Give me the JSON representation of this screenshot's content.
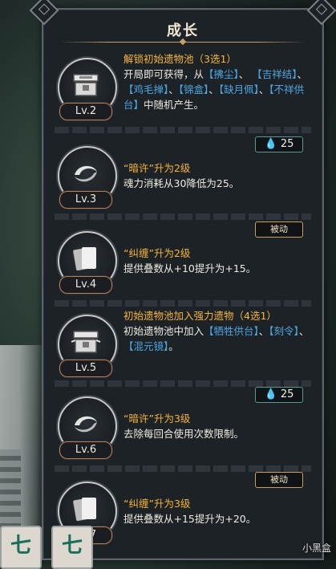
{
  "panel": {
    "title": "成长"
  },
  "entries": [
    {
      "level": "Lv.2",
      "icon": "chest-icon",
      "text_parts": [
        {
          "t": "解锁初始遗物池（3选1）",
          "c": "hl"
        },
        {
          "t": "开局即可获得，从",
          "c": ""
        },
        {
          "t": "【拂尘】",
          "c": "blue"
        },
        {
          "t": "、",
          "c": ""
        },
        {
          "t": "【吉祥结】",
          "c": "blue"
        },
        {
          "t": "、",
          "c": ""
        },
        {
          "t": "【鸡毛掸】",
          "c": "blue"
        },
        {
          "t": "、",
          "c": ""
        },
        {
          "t": "【锦盒】",
          "c": "blue"
        },
        {
          "t": "、",
          "c": ""
        },
        {
          "t": "【缺月佩】",
          "c": "blue"
        },
        {
          "t": "、",
          "c": ""
        },
        {
          "t": "【不祥供台】",
          "c": "blue"
        },
        {
          "t": "中随机产生。",
          "c": ""
        }
      ],
      "badge": null
    },
    {
      "level": "Lv.3",
      "icon": "swirl-icon",
      "title": "“暗许”升为2级",
      "desc": "魂力消耗从30降低为25。",
      "badge": {
        "type": "cost",
        "value": "25"
      }
    },
    {
      "level": "Lv.4",
      "icon": "cards-icon",
      "title": "“纠缠”升为2级",
      "desc": "提供叠数从+10提升为+15。",
      "badge": {
        "type": "passive",
        "value": "被动"
      }
    },
    {
      "level": "Lv.5",
      "icon": "chest-icon",
      "text_parts": [
        {
          "t": "初始遗物池加入强力遗物（4选1）",
          "c": "hl"
        },
        {
          "t": "初始遗物池中加入",
          "c": ""
        },
        {
          "t": "【牺牲供台】",
          "c": "blue"
        },
        {
          "t": "、",
          "c": ""
        },
        {
          "t": "【刻令】",
          "c": "blue"
        },
        {
          "t": "、",
          "c": ""
        },
        {
          "t": "【混元镜】",
          "c": "blue"
        },
        {
          "t": "。",
          "c": ""
        }
      ],
      "badge": null
    },
    {
      "level": "Lv.6",
      "icon": "swirl-icon",
      "title": "“暗许”升为3级",
      "desc": "去除每回合使用次数限制。",
      "badge": {
        "type": "cost",
        "value": "25"
      }
    },
    {
      "level": "Lv.7",
      "icon": "cards-icon",
      "title": "“纠缠”升为3级",
      "desc": "提供叠数从+15提升为+20。",
      "badge": {
        "type": "passive",
        "value": "被动"
      }
    }
  ],
  "tiles": [
    "七",
    "七"
  ],
  "watermark": "小黑盒",
  "colors": {
    "highlight": "#f4b53c",
    "keyword": "#4da6e0",
    "panel": "#1d2227"
  }
}
